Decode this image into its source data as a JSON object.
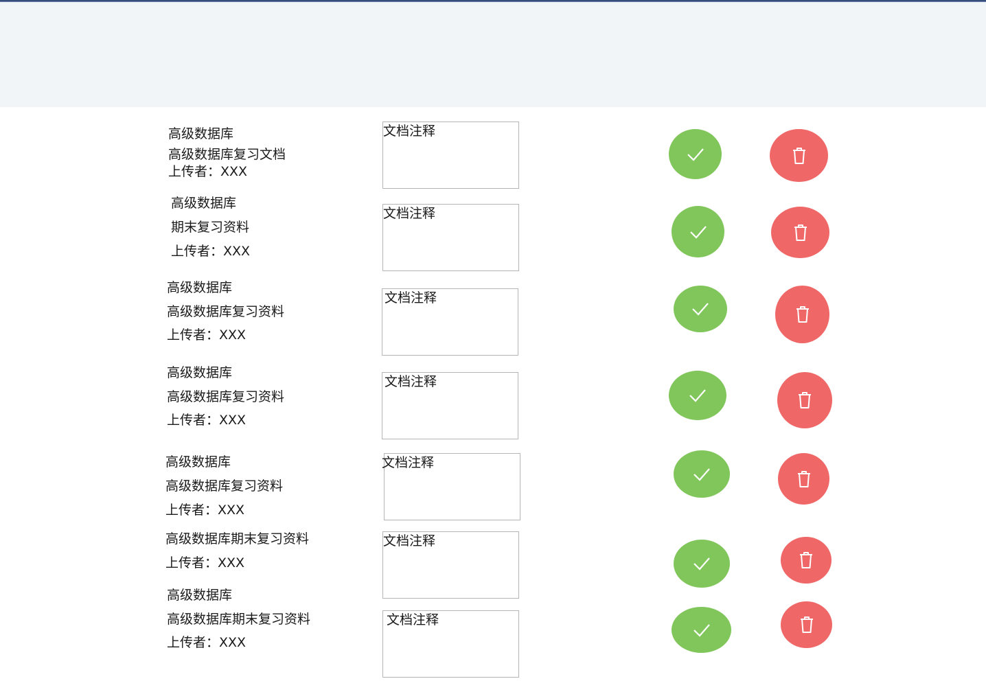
{
  "note_label": "文档注释",
  "colors": {
    "approve": "#80c65a",
    "delete": "#f06767",
    "header_band": "#f2f5f8"
  },
  "icons": {
    "approve": "check-icon",
    "delete": "trash-icon"
  },
  "documents": [
    {
      "lines": [
        "高级数据库",
        "高级数据库复习文档",
        "上传者：XXX"
      ]
    },
    {
      "lines": [
        "高级数据库",
        "期末复习资料",
        "上传者：XXX"
      ]
    },
    {
      "lines": [
        "高级数据库",
        "高级数据库复习资料",
        "上传者：XXX"
      ]
    },
    {
      "lines": [
        "高级数据库",
        "高级数据库复习资料",
        "上传者：XXX"
      ]
    },
    {
      "lines": [
        "高级数据库",
        "高级数据库复习资料",
        "上传者：XXX"
      ]
    },
    {
      "lines": [
        "高级数据库期末复习资料",
        "上传者：XXX"
      ]
    },
    {
      "lines": [
        "高级数据库",
        "高级数据库期末复习资料",
        "上传者：XXX"
      ]
    }
  ]
}
